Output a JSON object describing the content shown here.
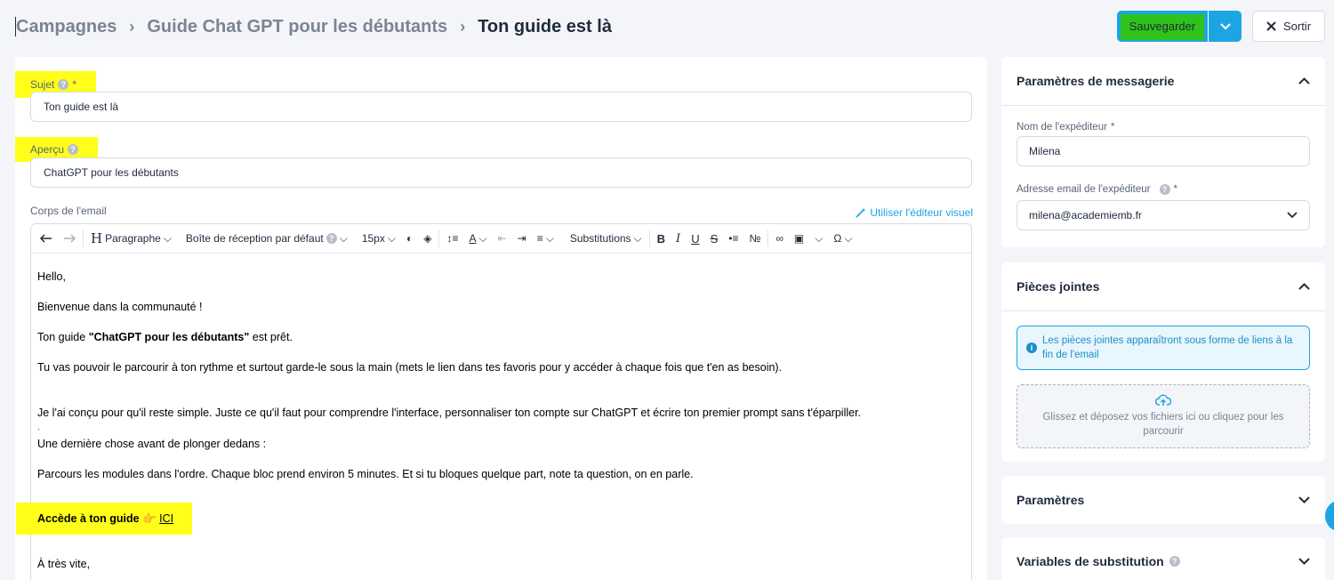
{
  "header": {
    "breadcrumb": [
      "Campagnes",
      "Guide Chat GPT pour les débutants",
      "Ton guide est là"
    ],
    "save_label": "Sauvegarder",
    "exit_label": "Sortir"
  },
  "subject": {
    "label": "Sujet",
    "required_mark": "*",
    "value": "Ton guide est là"
  },
  "preview": {
    "label": "Aperçu",
    "value": "ChatGPT pour les débutants"
  },
  "body_label": "Corps de l'email",
  "visual_editor_label": "Utiliser l'éditeur visuel",
  "toolbar": {
    "paragraph_label": "Paragraphe",
    "inbox_label": "Boîte de réception par défaut",
    "font_size": "15px",
    "substitutions_label": "Substitutions"
  },
  "email_body": {
    "greeting": "Hello,",
    "welcome": "Bienvenue dans la communauté !",
    "guide_prefix": "Ton guide ",
    "guide_title": "\"ChatGPT pour les débutants\"",
    "guide_suffix": " est prêt.",
    "line_browse": "Tu vas pouvoir le parcourir à ton rythme et surtout garde-le sous la main (mets le lien dans tes favoris pour y accéder à chaque fois que t'en as besoin).",
    "line_simple": "Je l'ai conçu pour qu'il reste simple. Juste ce qu'il faut pour comprendre l'interface, personnaliser ton compte sur ChatGPT et écrire ton premier prompt sans t'éparpiller.",
    "dot": ".",
    "line_last": "Une dernière chose avant de plonger dedans :",
    "line_modules": "Parcours les modules dans l'ordre. Chaque bloc prend environ 5 minutes. Et si tu bloques quelque part, note ta question, on en parle.",
    "cta_text": "Accède à ton guide",
    "cta_emoji": "👉",
    "cta_link": "ICI",
    "closing": "À très vite,"
  },
  "messaging": {
    "title": "Paramètres de messagerie",
    "sender_name_label": "Nom de l'expéditeur",
    "sender_name_value": "Milena",
    "sender_email_label": "Adresse email de l'expéditeur",
    "sender_email_value": "milena@academiemb.fr",
    "required_mark": "*"
  },
  "attachments": {
    "title": "Pièces jointes",
    "info": "Les pièces jointes apparaîtront sous forme de liens à la fin de l'email",
    "drop": "Glissez et déposez vos fichiers ici ou cliquez pour les parcourir"
  },
  "params": {
    "title": "Paramètres"
  },
  "substitution_vars": {
    "title": "Variables de substitution"
  },
  "colors": {
    "accent": "#1da5e3",
    "highlight": "#ffff1a",
    "save_highlight": "#2fc21a"
  }
}
